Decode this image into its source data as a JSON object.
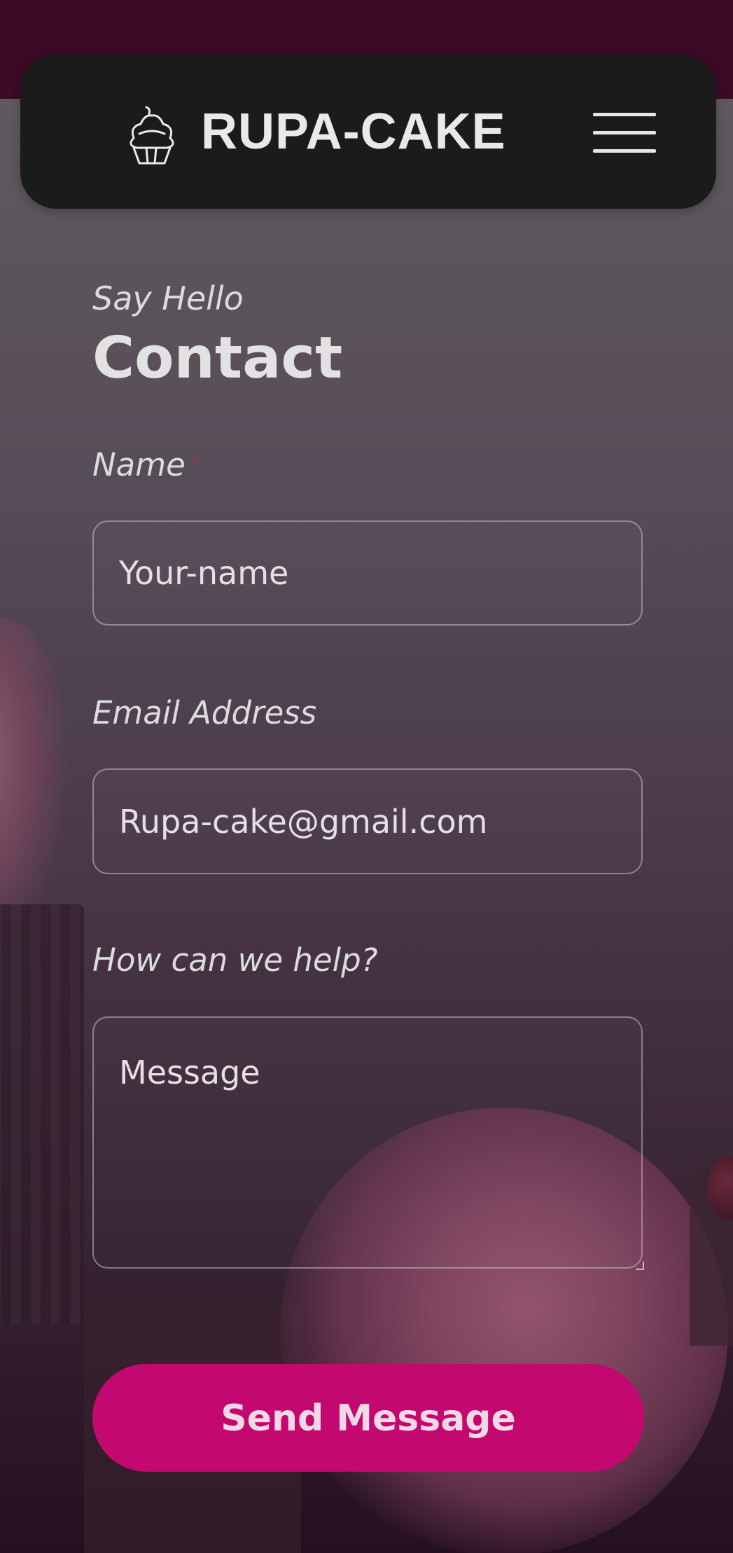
{
  "header": {
    "brand": "RUPA-CAKE",
    "logo_icon": "cupcake-icon",
    "menu_icon": "hamburger-menu-icon"
  },
  "contact": {
    "eyebrow": "Say Hello",
    "title": "Contact"
  },
  "form": {
    "name_label": "Name",
    "name_required_marker": "*",
    "name_placeholder": "Your-name",
    "email_label": "Email Address",
    "email_placeholder": "Rupa-cake@gmail.com",
    "message_label": "How can we help?",
    "message_placeholder": "Message",
    "submit_label": "Send Message"
  },
  "colors": {
    "header_bg": "#1b1b1b",
    "top_strip": "#3c0a26",
    "accent": "#c3096f",
    "required_star": "#b5303d"
  }
}
